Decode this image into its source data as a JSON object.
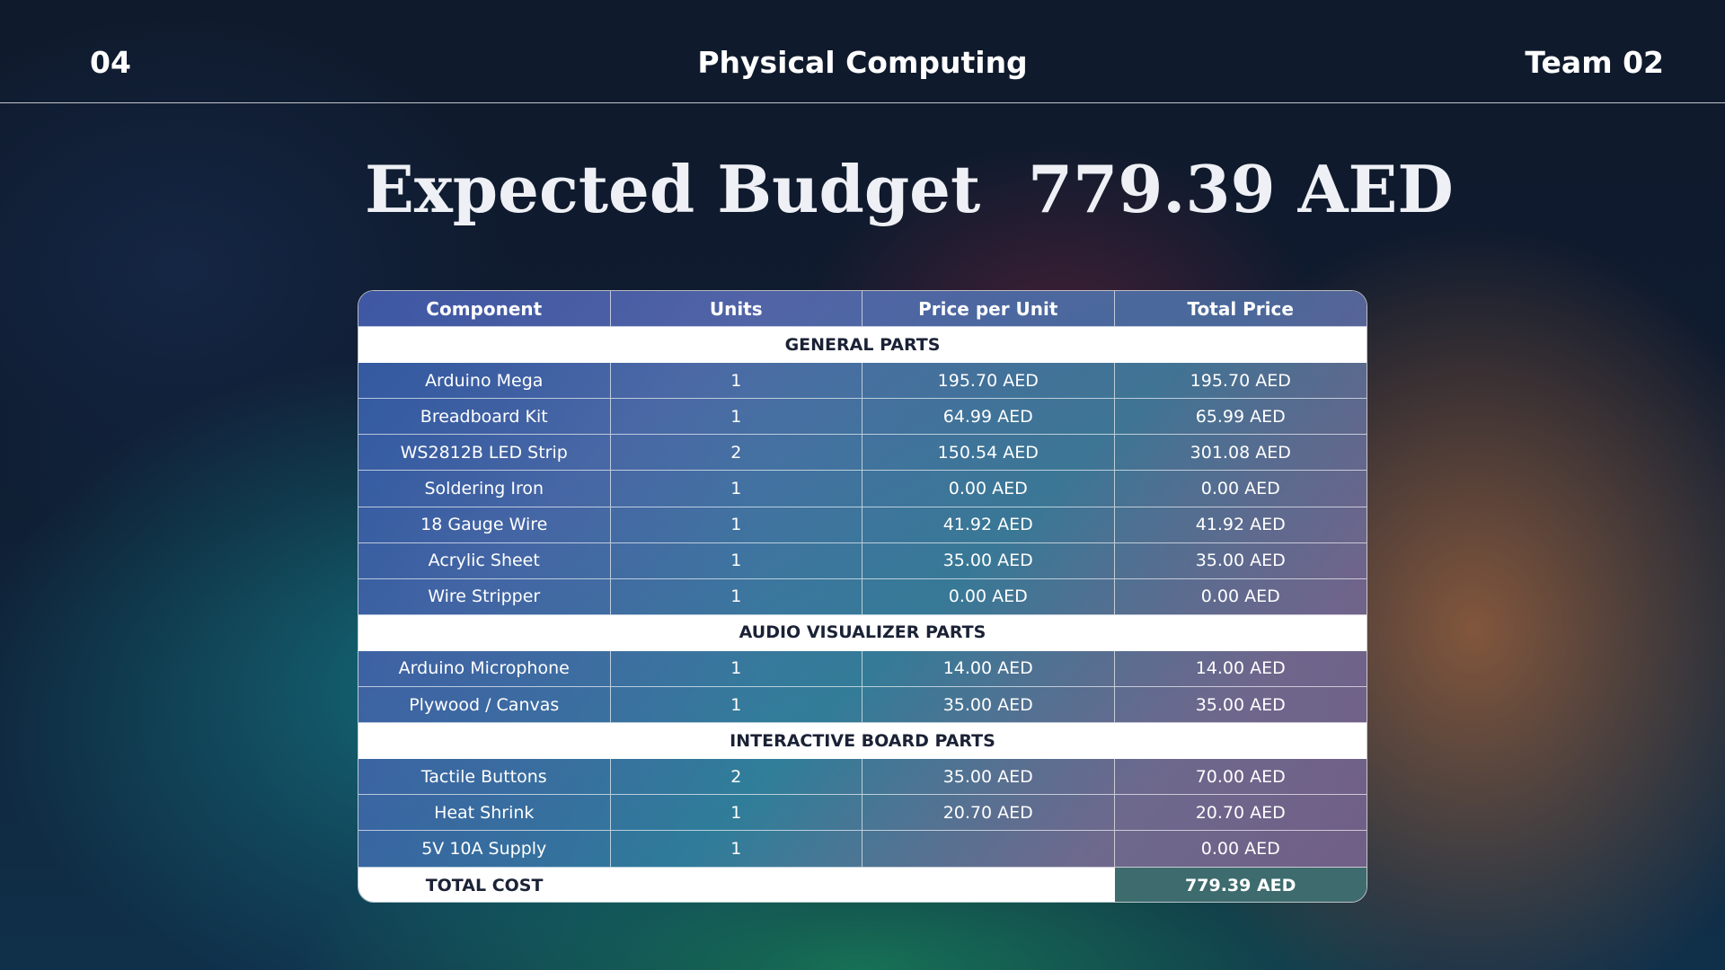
{
  "header": {
    "slide_number": "04",
    "course": "Physical Computing",
    "team": "Team 02"
  },
  "title": {
    "heading": "Expected Budget",
    "amount": "779.39 AED"
  },
  "table": {
    "columns": [
      "Component",
      "Units",
      "Price per Unit",
      "Total Price"
    ],
    "sections": [
      {
        "name": "GENERAL PARTS",
        "rows": [
          [
            "Arduino Mega",
            "1",
            "195.70 AED",
            "195.70 AED"
          ],
          [
            "Breadboard Kit",
            "1",
            "64.99 AED",
            "65.99 AED"
          ],
          [
            "WS2812B LED Strip",
            "2",
            "150.54 AED",
            "301.08 AED"
          ],
          [
            "Soldering Iron",
            "1",
            "0.00 AED",
            "0.00 AED"
          ],
          [
            "18 Gauge Wire",
            "1",
            "41.92 AED",
            "41.92 AED"
          ],
          [
            "Acrylic Sheet",
            "1",
            "35.00 AED",
            "35.00 AED"
          ],
          [
            "Wire Stripper",
            "1",
            "0.00 AED",
            "0.00 AED"
          ]
        ]
      },
      {
        "name": "AUDIO VISUALIZER PARTS",
        "rows": [
          [
            "Arduino Microphone",
            "1",
            "14.00 AED",
            "14.00 AED"
          ],
          [
            "Plywood / Canvas",
            "1",
            "35.00 AED",
            "35.00 AED"
          ]
        ]
      },
      {
        "name": "INTERACTIVE BOARD PARTS",
        "rows": [
          [
            "Tactile Buttons",
            "2",
            "35.00 AED",
            "70.00 AED"
          ],
          [
            "Heat Shrink",
            "1",
            "20.70 AED",
            "20.70 AED"
          ],
          [
            "5V 10A Supply",
            "1",
            "",
            "0.00 AED"
          ]
        ]
      }
    ],
    "total_label": "TOTAL COST",
    "total_value": "779.39 AED"
  }
}
